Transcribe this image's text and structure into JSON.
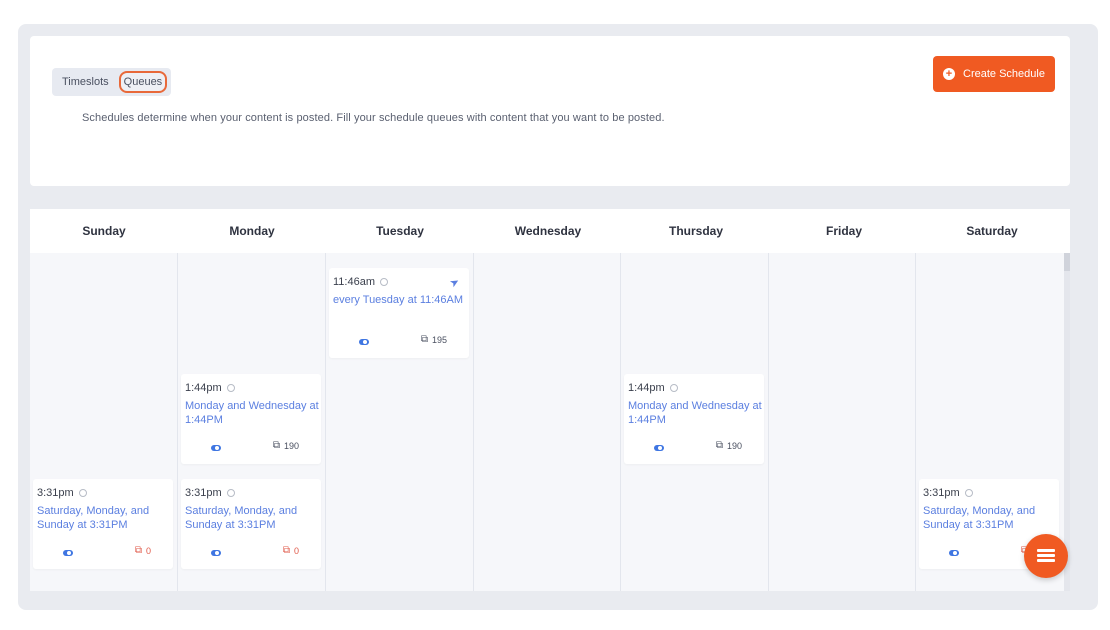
{
  "tabs": {
    "timeslots": "Timeslots",
    "queues": "Queues"
  },
  "description": "Schedules determine when your content is posted. Fill your schedule queues with content that you want to be posted.",
  "create_button": "Create Schedule",
  "days": [
    "Sunday",
    "Monday",
    "Tuesday",
    "Wednesday",
    "Thursday",
    "Friday",
    "Saturday"
  ],
  "slots": {
    "tue_1146": {
      "time": "11:46am",
      "freq": "every Tuesday at 11:46AM",
      "count": "195"
    },
    "mon_144": {
      "time": "1:44pm",
      "freq": "Monday and Wednesday at 1:44PM",
      "count": "190"
    },
    "thu_144": {
      "time": "1:44pm",
      "freq": "Monday and Wednesday at 1:44PM",
      "count": "190"
    },
    "sun_331": {
      "time": "3:31pm",
      "freq": "Saturday, Monday, and Sunday at 3:31PM",
      "count": "0"
    },
    "mon_331": {
      "time": "3:31pm",
      "freq": "Saturday, Monday, and Sunday at 3:31PM",
      "count": "0"
    },
    "sat_331": {
      "time": "3:31pm",
      "freq": "Saturday, Monday, and Sunday at 3:31PM",
      "count": "0"
    }
  },
  "icons": {
    "create": "plus-circle-icon",
    "clock": "clock-icon",
    "send": "send-icon",
    "copy": "copy-icon",
    "fab": "menu-stack-icon"
  },
  "colors": {
    "accent": "#f05a22",
    "link": "#5b7fe0",
    "toggle": "#3f76e2",
    "zero_count": "#e05a4a"
  }
}
